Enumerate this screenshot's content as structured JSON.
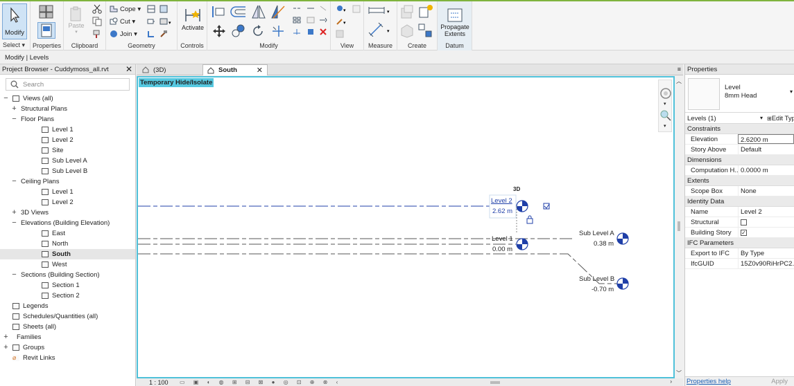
{
  "ribbon": {
    "modify_label": "Modify",
    "select_label": "Select",
    "properties_label": "Properties",
    "clipboard": {
      "paste_label": "Paste",
      "group_label": "Clipboard"
    },
    "geometry": {
      "cope_label": "Cope",
      "cut_label": "Cut",
      "join_label": "Join",
      "group_label": "Geometry"
    },
    "controls": {
      "activate_label": "Activate",
      "group_label": "Controls"
    },
    "modify_group_label": "Modify",
    "view_group_label": "View",
    "measure_group_label": "Measure",
    "create_group_label": "Create",
    "datum": {
      "propagate_line1": "Propagate",
      "propagate_line2": "Extents",
      "group_label": "Datum"
    }
  },
  "context_bar": "Modify | Levels",
  "project_browser": {
    "title": "Project Browser - Cuddymoss_all.rvt",
    "search_placeholder": "Search",
    "items": [
      {
        "label": "Views (all)",
        "indent": 0,
        "toggle": "−",
        "icon": "views"
      },
      {
        "label": "Structural Plans",
        "indent": 1,
        "toggle": "+"
      },
      {
        "label": "Floor Plans",
        "indent": 1,
        "toggle": "−"
      },
      {
        "label": "Level 1",
        "indent": 2,
        "icon": "view"
      },
      {
        "label": "Level 2",
        "indent": 2,
        "icon": "view"
      },
      {
        "label": "Site",
        "indent": 2,
        "icon": "view"
      },
      {
        "label": "Sub Level A",
        "indent": 2,
        "icon": "view"
      },
      {
        "label": "Sub Level B",
        "indent": 2,
        "icon": "view"
      },
      {
        "label": "Ceiling Plans",
        "indent": 1,
        "toggle": "−"
      },
      {
        "label": "Level 1",
        "indent": 2,
        "icon": "view"
      },
      {
        "label": "Level 2",
        "indent": 2,
        "icon": "view"
      },
      {
        "label": "3D Views",
        "indent": 1,
        "toggle": "+"
      },
      {
        "label": "Elevations (Building Elevation)",
        "indent": 1,
        "toggle": "−"
      },
      {
        "label": "East",
        "indent": 2,
        "icon": "view"
      },
      {
        "label": "North",
        "indent": 2,
        "icon": "view"
      },
      {
        "label": "South",
        "indent": 2,
        "icon": "view",
        "selected": true
      },
      {
        "label": "West",
        "indent": 2,
        "icon": "view"
      },
      {
        "label": "Sections (Building Section)",
        "indent": 1,
        "toggle": "−"
      },
      {
        "label": "Section 1",
        "indent": 2,
        "icon": "view"
      },
      {
        "label": "Section 2",
        "indent": 2,
        "icon": "view"
      },
      {
        "label": "Legends",
        "indent": 0,
        "icon": "legend"
      },
      {
        "label": "Schedules/Quantities (all)",
        "indent": 0,
        "icon": "schedule"
      },
      {
        "label": "Sheets (all)",
        "indent": 0,
        "icon": "sheet"
      },
      {
        "label": "Families",
        "indent": 0,
        "toggle": "+"
      },
      {
        "label": "Groups",
        "indent": 0,
        "toggle": "+",
        "icon": "group"
      },
      {
        "label": "Revit Links",
        "indent": 0,
        "icon": "link"
      }
    ]
  },
  "tabs": [
    {
      "label": "(3D)",
      "active": false
    },
    {
      "label": "South",
      "active": true
    }
  ],
  "canvas": {
    "temp_hide_label": "Temporary Hide/Isolate",
    "three_d_label": "3D",
    "levels": [
      {
        "name": "Level 2",
        "value": "2.62 m"
      },
      {
        "name": "Level 1",
        "value": "0.00 m"
      },
      {
        "name": "Sub Level A",
        "value": "0.38 m"
      },
      {
        "name": "Sub Level B",
        "value": "-0.70 m"
      }
    ]
  },
  "status": {
    "scale": "1 : 100"
  },
  "properties": {
    "title": "Properties",
    "type_line1": "Level",
    "type_line2": "8mm Head",
    "instance_filter": "Levels (1)",
    "edit_type": "Edit Typ",
    "sections": [
      {
        "name": "Constraints",
        "rows": [
          {
            "key": "Elevation",
            "value": "2.6200 m",
            "editing": true
          },
          {
            "key": "Story Above",
            "value": "Default"
          }
        ]
      },
      {
        "name": "Dimensions",
        "rows": [
          {
            "key": "Computation H...",
            "value": "0.0000 m"
          }
        ]
      },
      {
        "name": "Extents",
        "rows": [
          {
            "key": "Scope Box",
            "value": "None"
          }
        ]
      },
      {
        "name": "Identity Data",
        "rows": [
          {
            "key": "Name",
            "value": "Level 2"
          },
          {
            "key": "Structural",
            "value": "",
            "checkbox": false
          },
          {
            "key": "Building Story",
            "value": "",
            "checkbox": true
          }
        ]
      },
      {
        "name": "IFC Parameters",
        "rows": [
          {
            "key": "Export to IFC",
            "value": "By Type"
          },
          {
            "key": "IfcGUID",
            "value": "15Z0v90RiHrPC2..."
          }
        ]
      }
    ],
    "help_link": "Properties help",
    "apply_label": "Apply"
  },
  "colors": {
    "accent_green": "#7fb33d",
    "view_border": "#4fc1d9",
    "level_blue": "#1f3fa8",
    "highlight": "#56c8e0"
  }
}
